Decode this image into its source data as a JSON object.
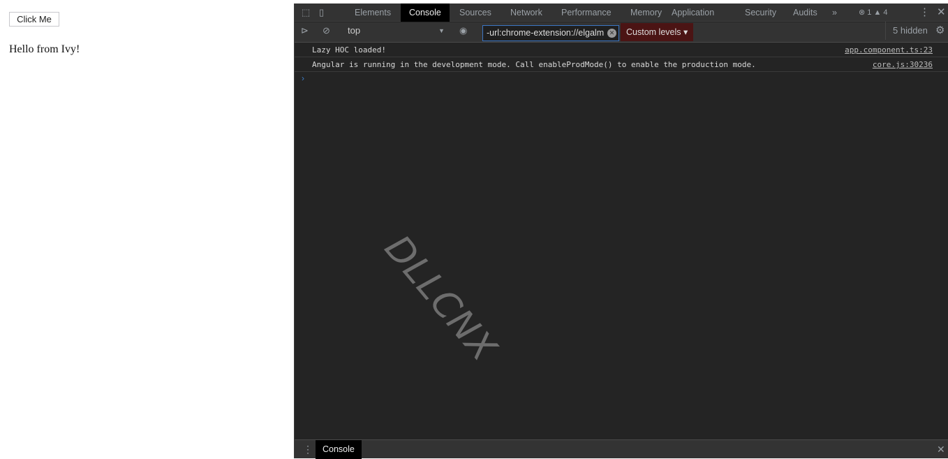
{
  "page": {
    "button_label": "Click Me",
    "text": "Hello from Ivy!"
  },
  "devtools": {
    "tabs": [
      "Elements",
      "Console",
      "Sources",
      "Network",
      "Performance",
      "Memory",
      "Application",
      "Security",
      "Audits"
    ],
    "active_tab": "Console",
    "more_tabs": "»",
    "errors": "1",
    "warnings": "4",
    "context": "top",
    "filter_value": "-url:chrome-extension://elgalm",
    "levels": "Custom levels ▾",
    "hidden": "5 hidden",
    "messages": [
      {
        "text": "Lazy HOC loaded!",
        "source": "app.component.ts:23"
      },
      {
        "text": "Angular is running in the development mode. Call enableProdMode() to enable the production mode.",
        "source": "core.js:30236"
      }
    ],
    "prompt": "›",
    "watermark": "DLLCNX",
    "drawer_tab": "Console"
  }
}
